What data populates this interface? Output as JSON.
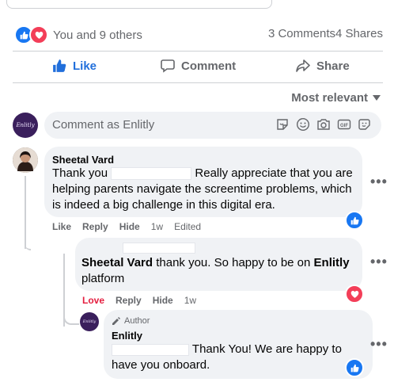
{
  "colors": {
    "accent": "#216fdb",
    "love": "#e41e3f",
    "muted": "#65676b",
    "bubble": "#f0f2f5"
  },
  "post_stats": {
    "reactions_text": "You and 9 others",
    "reaction_icons": [
      "like-icon",
      "love-icon"
    ],
    "comments": "3 Comments",
    "shares": "4 Shares"
  },
  "actions": {
    "like": "Like",
    "comment": "Comment",
    "share": "Share"
  },
  "sort": {
    "label": "Most relevant"
  },
  "composer": {
    "placeholder": "Comment as Enlitly",
    "avatar_text": "Enlitly",
    "tools": [
      "sticker-icon",
      "emoji-icon",
      "camera-icon",
      "gif-icon",
      "avatar-sticker-icon"
    ],
    "gif_label": "GIF"
  },
  "comments": [
    {
      "author": "Sheetal Vard",
      "text_before": "Thank you",
      "text_after": "Really appreciate that you are helping parents navigate the screentime problems, which is indeed a big challenge in this digital era.",
      "reaction_icon": "like-icon",
      "meta": {
        "like": "Like",
        "reply": "Reply",
        "hide": "Hide",
        "time": "1w",
        "edited": "Edited"
      }
    },
    {
      "author": "Sheetal Vard",
      "text_before": "thank you. So happy to be on",
      "mention": "Enlitly",
      "text_after": "platform",
      "reaction_icon": "love-icon",
      "meta": {
        "love": "Love",
        "reply": "Reply",
        "hide": "Hide",
        "time": "1w"
      }
    },
    {
      "badge": "Author",
      "author": "Enlitly",
      "avatar_text": "Enlitly",
      "text_line1": "Thank You! We are happy to",
      "text_line2": "have you onboard.",
      "reaction_icon": "like-icon"
    }
  ],
  "more_label": "•••"
}
